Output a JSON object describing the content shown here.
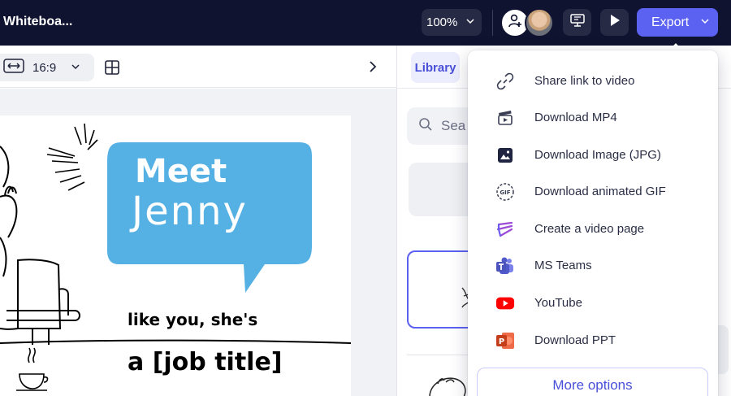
{
  "topbar": {
    "title": "Whiteboa...",
    "zoom": "100%",
    "export_label": "Export"
  },
  "editor_toolbar": {
    "aspect_ratio": "16:9"
  },
  "slide": {
    "bubble_line_1": "Meet",
    "bubble_line_2": "Jenny",
    "text_line_1": "like you, she's",
    "text_line_2": "a [job title]",
    "bubble_color": "#55b0e3"
  },
  "right_panel": {
    "active_tab": "Library",
    "search_placeholder": "Sea"
  },
  "export_menu": {
    "items": [
      {
        "label": "Share link to video",
        "icon": "link-icon"
      },
      {
        "label": "Download MP4",
        "icon": "video-clapper-icon"
      },
      {
        "label": "Download Image (JPG)",
        "icon": "image-icon"
      },
      {
        "label": "Download animated GIF",
        "icon": "gif-icon"
      },
      {
        "label": "Create a video page",
        "icon": "video-page-icon"
      },
      {
        "label": "MS Teams",
        "icon": "ms-teams-icon"
      },
      {
        "label": "YouTube",
        "icon": "youtube-icon"
      },
      {
        "label": "Download PPT",
        "icon": "powerpoint-icon"
      }
    ],
    "more_options": "More options"
  },
  "colors": {
    "topbar_bg": "#0f1330",
    "accent": "#5b61f0",
    "youtube_red": "#ff0000",
    "teams_purple": "#5059c9",
    "ppt_orange": "#d35230"
  }
}
